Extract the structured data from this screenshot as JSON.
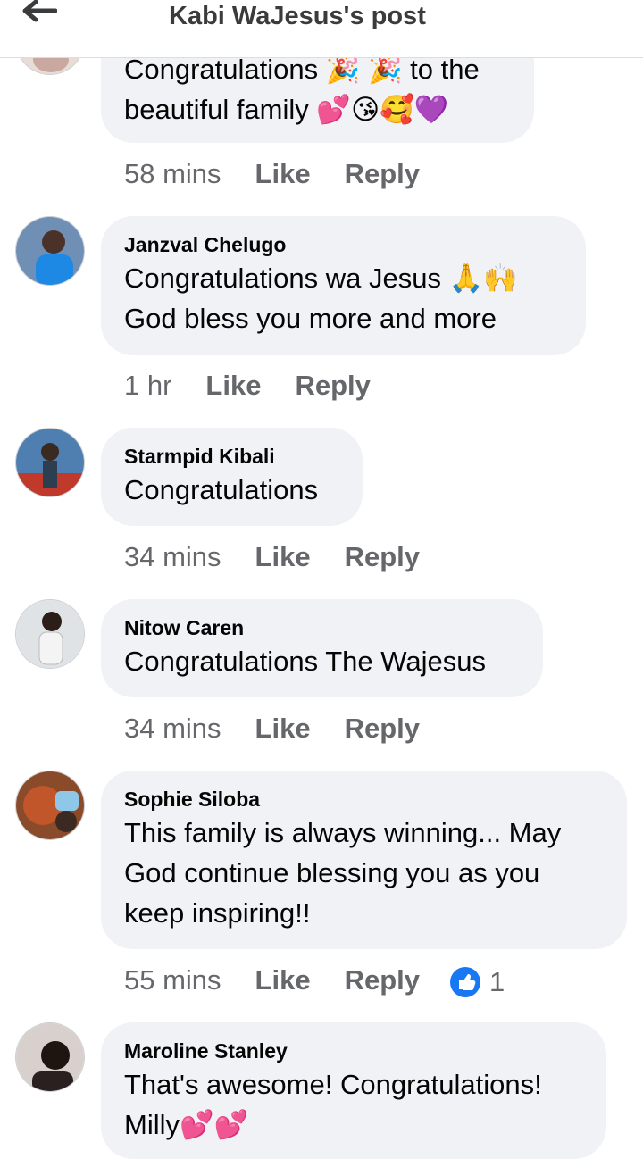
{
  "header": {
    "title": "Kabi WaJesus's post",
    "back_icon": "arrow-left-icon"
  },
  "actions": {
    "like": "Like",
    "reply": "Reply"
  },
  "comments": [
    {
      "author": "",
      "lines": [
        "Congratulations 🎉 🎉 to the",
        "beautiful family 💕😘🥰💜"
      ],
      "time": "58 mins"
    },
    {
      "author": "Janzval Chelugo",
      "lines": [
        "Congratulations wa Jesus 🙏🙌",
        "God bless you more and more"
      ],
      "time": "1 hr"
    },
    {
      "author": "Starmpid Kibali",
      "lines": [
        "Congratulations"
      ],
      "time": "34 mins"
    },
    {
      "author": "Nitow Caren",
      "lines": [
        "Congratulations The Wajesus"
      ],
      "time": "34 mins"
    },
    {
      "author": "Sophie Siloba",
      "lines": [
        "This family is always winning... May",
        "God continue blessing you as you",
        "keep inspiring!!"
      ],
      "time": "55 mins",
      "reaction_count": "1"
    },
    {
      "author": "Maroline Stanley",
      "lines": [
        "That's awesome! Congratulations!",
        "Milly💕💕"
      ]
    }
  ],
  "colors": {
    "bubble": "#f0f2f5",
    "meta": "#65676b",
    "like_blue": "#1877f2"
  }
}
